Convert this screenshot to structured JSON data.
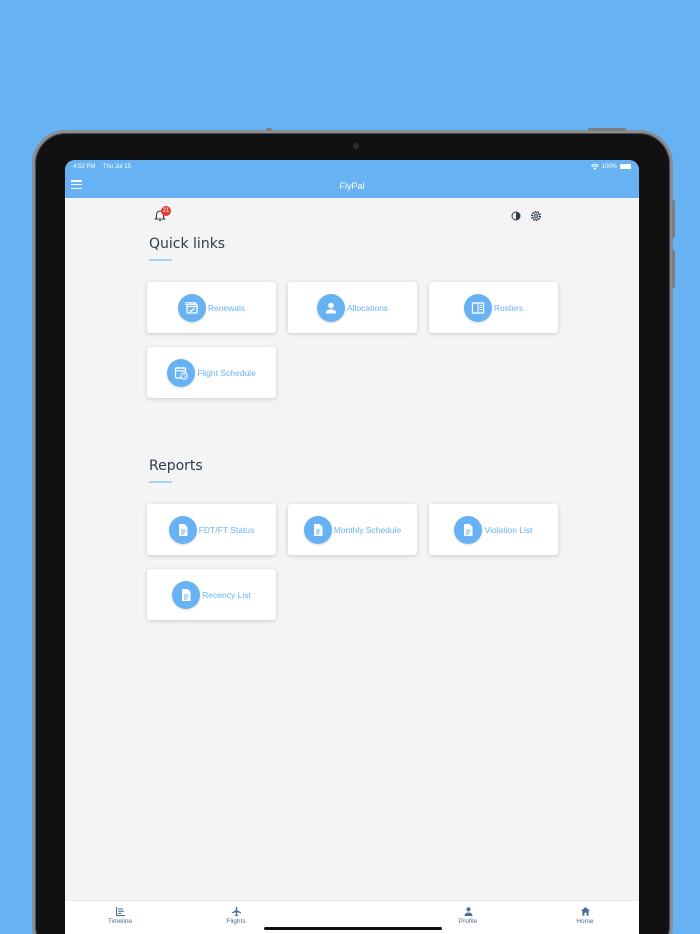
{
  "status_bar": {
    "time": "4:52 PM",
    "date": "Thu Jul 15",
    "battery": "100%"
  },
  "nav": {
    "title": "FlyPal"
  },
  "notifications": {
    "badge": "21"
  },
  "quick_links": {
    "title": "Quick links",
    "items": [
      {
        "label": "Renewals",
        "icon": "renewals-calendar-icon"
      },
      {
        "label": "Allocations",
        "icon": "person-icon"
      },
      {
        "label": "Rosters",
        "icon": "roster-book-icon"
      },
      {
        "label": "Flight Schedule",
        "icon": "calendar-clock-icon"
      }
    ]
  },
  "reports": {
    "title": "Reports",
    "items": [
      {
        "label": "FDT/FT Status",
        "icon": "document-icon"
      },
      {
        "label": "Monthly Schedule",
        "icon": "document-icon"
      },
      {
        "label": "Violation List",
        "icon": "document-icon"
      },
      {
        "label": "Recency List",
        "icon": "document-icon"
      }
    ]
  },
  "tabs": [
    {
      "label": "Timeline",
      "icon": "timeline-chart-icon"
    },
    {
      "label": "Flights",
      "icon": "airplane-icon"
    },
    {
      "label": "Profile",
      "icon": "person-icon"
    },
    {
      "label": "Home",
      "icon": "home-icon"
    }
  ],
  "colors": {
    "accent": "#67b2f2",
    "background": "#f4f4f4",
    "badge": "#e53935",
    "heading": "#2e3b4a"
  }
}
